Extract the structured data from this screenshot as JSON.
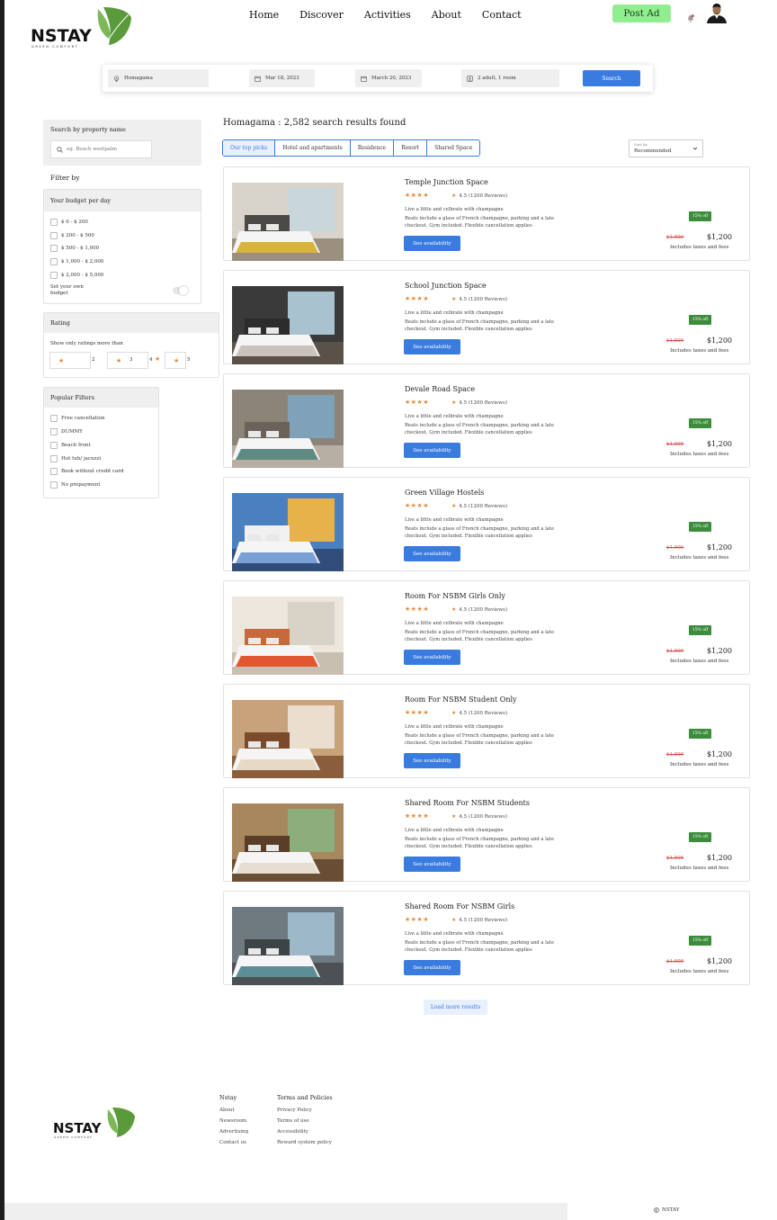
{
  "header": {
    "brand": "NSTAY",
    "brand_tagline": "GREEN COMFORT",
    "nav": [
      "Home",
      "Discover",
      "Activities",
      "About",
      "Contact"
    ],
    "post_ad": "Post Ad"
  },
  "search": {
    "location": "Homagama",
    "checkin": "Mar 18, 2023",
    "checkout": "March 20, 2023",
    "guests": "2 adult, 1 room",
    "button": "Search"
  },
  "sidebar": {
    "property_search": {
      "title": "Search by property name",
      "placeholder": "eg. Beach westpalm"
    },
    "filter_by": "Filter by",
    "budget": {
      "title": "Your budget per day",
      "options": [
        "$ 0 - $ 200",
        "$ 200 - $ 500",
        "$ 500 - $ 1,000",
        "$ 1,000 - $ 2,000",
        "$ 2,000 - $ 5,000"
      ],
      "own_budget": "Set your own budget"
    },
    "rating": {
      "title": "Rating",
      "subtitle": "Show only ratings more than",
      "values": [
        "2",
        "3",
        "4",
        "5"
      ]
    },
    "popular": {
      "title": "Popular Filters",
      "options": [
        "Free cancellation",
        "DUMMY",
        "Beach front",
        "Hot tub/ jacuzzi",
        "Book without credit card",
        "No prepayment"
      ]
    }
  },
  "results": {
    "title": "Homagama : 2,582 search results found",
    "tabs": [
      "Our top picks",
      "Hotel and apartments",
      "Residence",
      "Resort",
      "Shared Space"
    ],
    "sort_label": "Sort by",
    "sort_value": "Recommended",
    "load_more": "Load more results",
    "cards": [
      {
        "title": "Temple Junction Space",
        "stars": "★★★★",
        "rating": "4.5 (1200 Reviews)",
        "tagline": "Live a little and celbrate with champagne",
        "desc": "Reats include a glass of French champagne, parking and a late checkout. Gym included. Flexible cancellation applies",
        "button": "See availability",
        "badge": "15% off",
        "old_price": "$1,500",
        "price": "$1,200",
        "taxes": "Includes taxes and fees"
      },
      {
        "title": "School Junction Space",
        "stars": "★★★★",
        "rating": "4.5 (1200 Reviews)",
        "tagline": "Live a little and celbrate with champagne",
        "desc": "Reats include a glass of French champagne, parking and a late checkout. Gym included. Flexible cancellation applies",
        "button": "See availability",
        "badge": "15% off",
        "old_price": "$1,500",
        "price": "$1,200",
        "taxes": "Includes taxes and fees"
      },
      {
        "title": "Devale Road Space",
        "stars": "★★★★",
        "rating": "4.5 (1200 Reviews)",
        "tagline": "Live a little and celbrate with champagne",
        "desc": "Reats include a glass of French champagne, parking and a late checkout. Gym included. Flexible cancellation applies",
        "button": "See availability",
        "badge": "15% off",
        "old_price": "$1,500",
        "price": "$1,200",
        "taxes": "Includes taxes and fees"
      },
      {
        "title": "Green Village Hostels",
        "stars": "★★★★",
        "rating": "4.5 (1200 Reviews)",
        "tagline": "Live a little and celbrate with champagne",
        "desc": "Reats include a glass of French champagne, parking and a late checkout. Gym included. Flexible cancellation applies",
        "button": "See availability",
        "badge": "15% off",
        "old_price": "$1,500",
        "price": "$1,200",
        "taxes": "Includes taxes and fees"
      },
      {
        "title": "Room For NSBM Girls Only",
        "stars": "★★★★",
        "rating": "4.5 (1200 Reviews)",
        "tagline": "Live a little and celbrate with champagne",
        "desc": "Reats include a glass of French champagne, parking and a late checkout. Gym included. Flexible cancellation applies",
        "button": "See availability",
        "badge": "15% off",
        "old_price": "$1,500",
        "price": "$1,200",
        "taxes": "Includes taxes and fees"
      },
      {
        "title": "Room For NSBM Student Only",
        "stars": "★★★★",
        "rating": "4.5 (1200 Reviews)",
        "tagline": "Live a little and celbrate with champagne",
        "desc": "Reats include a glass of French champagne, parking and a late checkout. Gym included. Flexible cancellation applies",
        "button": "See availability",
        "badge": "15% off",
        "old_price": "$1,500",
        "price": "$1,200",
        "taxes": "Includes taxes and fees"
      },
      {
        "title": "Shared Room For NSBM Students",
        "stars": "★★★★",
        "rating": "4.5 (1200 Reviews)",
        "tagline": "Live a little and celbrate with champagne",
        "desc": "Reats include a glass of French champagne, parking and a late checkout. Gym included. Flexible cancellation applies",
        "button": "See availability",
        "badge": "15% off",
        "old_price": "$1,500",
        "price": "$1,200",
        "taxes": "Includes taxes and fees"
      },
      {
        "title": "Shared Room For NSBM Girls",
        "stars": "★★★★",
        "rating": "4.5 (1200 Reviews)",
        "tagline": "Live a little and celbrate with champagne",
        "desc": "Reats include a glass of French champagne, parking and a late checkout. Gym included. Flexible cancellation applies",
        "button": "See availability",
        "badge": "15% off",
        "old_price": "$1,500",
        "price": "$1,200",
        "taxes": "Includes taxes and fees"
      }
    ]
  },
  "footer": {
    "col1": {
      "title": "Nstay",
      "links": [
        "About",
        "Newsroom",
        "Advertising",
        "Contact us"
      ]
    },
    "col2": {
      "title": "Terms and Policies",
      "links": [
        "Privacy Policy",
        "Terms of use",
        "Accessibility",
        "Reward system policy"
      ]
    },
    "copyright": "NSTAY"
  },
  "colors": {
    "accent": "#3a7be0",
    "post_ad": "#90ee90",
    "badge": "#3b8d3b",
    "star": "#e8883a",
    "old_price": "#d64545"
  }
}
